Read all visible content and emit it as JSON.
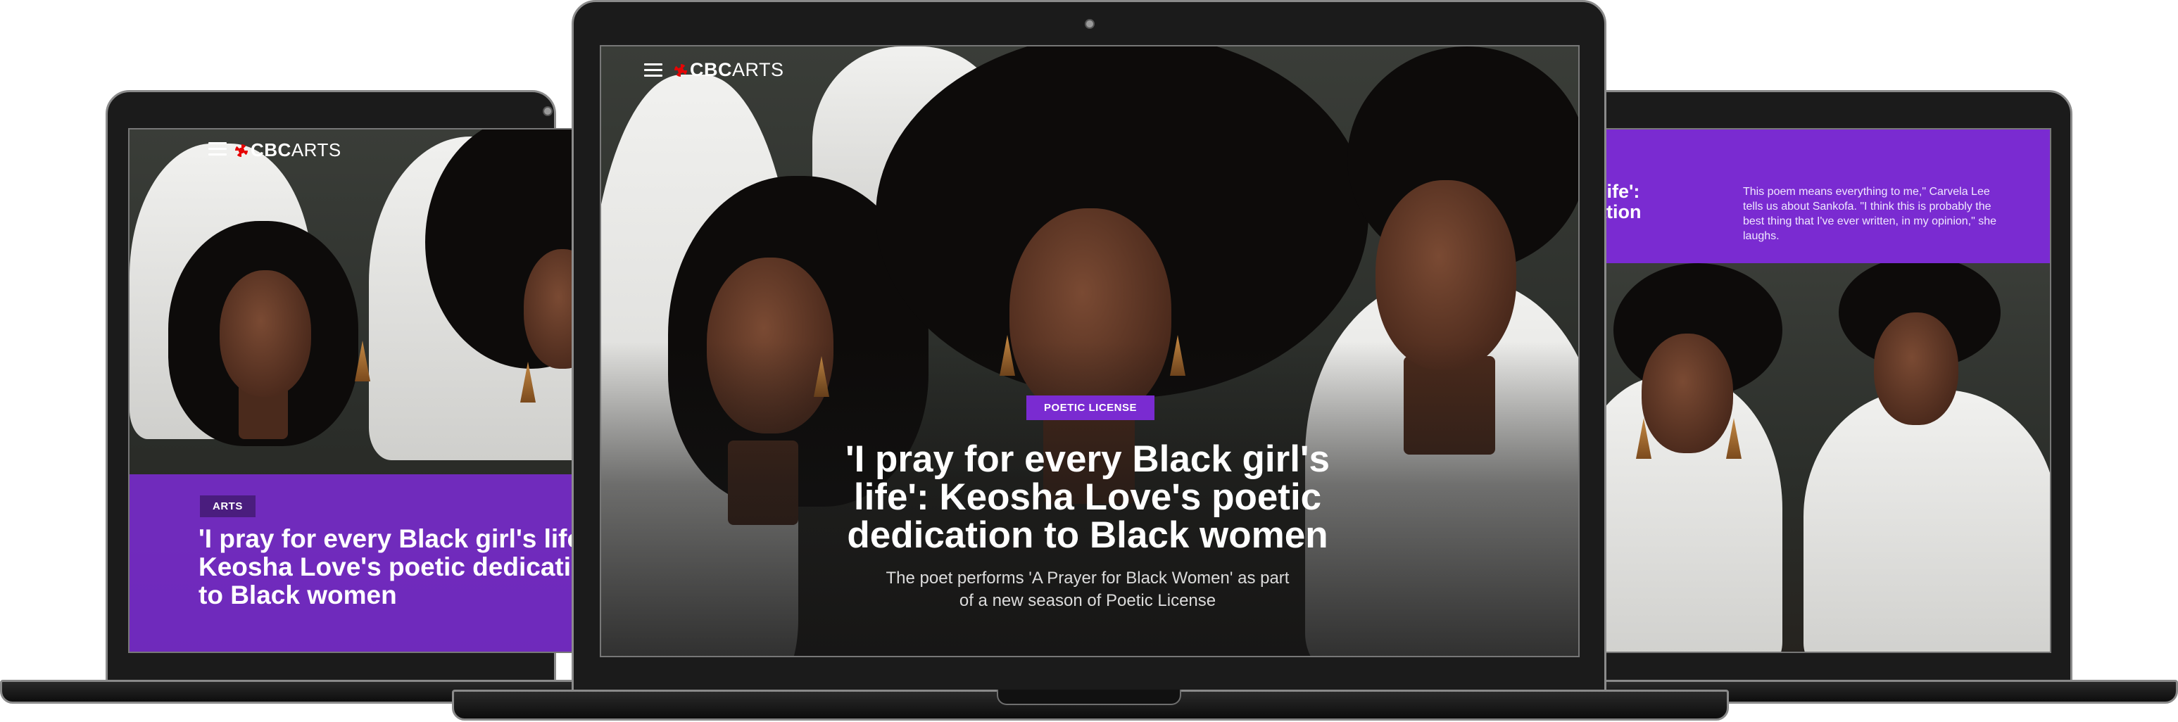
{
  "brand": {
    "cbc": "CBC",
    "arts": "ARTS"
  },
  "left_screen": {
    "badge": "ARTS",
    "headline": "'I pray for every Black girl's life': Keosha Love's poetic dedication to Black women"
  },
  "center_screen": {
    "badge": "POETIC LICENSE",
    "headline": "'I pray for every Black girl's life': Keosha Love's poetic dedication to Black women",
    "subtitle": "The poet performs 'A Prayer for Black Women' as part of a new season of Poetic License"
  },
  "right_screen": {
    "headline_fragment": "rl's life': dication",
    "quote": "This poem means everything to me,\" Carvela Lee tells us about Sankofa. \"I think this is probably the best thing that I've ever written, in my opinion,\" she laughs."
  },
  "icons": {
    "menu": "hamburger-menu-icon",
    "logo": "cbc-gem-icon"
  },
  "colors": {
    "accent": "#7a2bd1",
    "badge_dark": "#4a1d7e",
    "frame": "#1b1b1b"
  }
}
